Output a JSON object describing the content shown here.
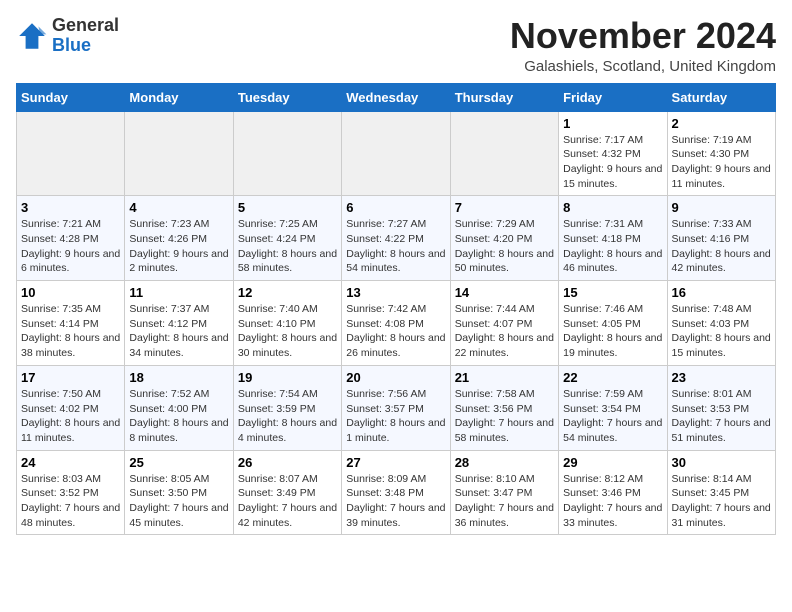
{
  "logo": {
    "general": "General",
    "blue": "Blue"
  },
  "title": "November 2024",
  "location": "Galashiels, Scotland, United Kingdom",
  "days_of_week": [
    "Sunday",
    "Monday",
    "Tuesday",
    "Wednesday",
    "Thursday",
    "Friday",
    "Saturday"
  ],
  "weeks": [
    [
      {
        "day": "",
        "info": ""
      },
      {
        "day": "",
        "info": ""
      },
      {
        "day": "",
        "info": ""
      },
      {
        "day": "",
        "info": ""
      },
      {
        "day": "",
        "info": ""
      },
      {
        "day": "1",
        "info": "Sunrise: 7:17 AM\nSunset: 4:32 PM\nDaylight: 9 hours and 15 minutes."
      },
      {
        "day": "2",
        "info": "Sunrise: 7:19 AM\nSunset: 4:30 PM\nDaylight: 9 hours and 11 minutes."
      }
    ],
    [
      {
        "day": "3",
        "info": "Sunrise: 7:21 AM\nSunset: 4:28 PM\nDaylight: 9 hours and 6 minutes."
      },
      {
        "day": "4",
        "info": "Sunrise: 7:23 AM\nSunset: 4:26 PM\nDaylight: 9 hours and 2 minutes."
      },
      {
        "day": "5",
        "info": "Sunrise: 7:25 AM\nSunset: 4:24 PM\nDaylight: 8 hours and 58 minutes."
      },
      {
        "day": "6",
        "info": "Sunrise: 7:27 AM\nSunset: 4:22 PM\nDaylight: 8 hours and 54 minutes."
      },
      {
        "day": "7",
        "info": "Sunrise: 7:29 AM\nSunset: 4:20 PM\nDaylight: 8 hours and 50 minutes."
      },
      {
        "day": "8",
        "info": "Sunrise: 7:31 AM\nSunset: 4:18 PM\nDaylight: 8 hours and 46 minutes."
      },
      {
        "day": "9",
        "info": "Sunrise: 7:33 AM\nSunset: 4:16 PM\nDaylight: 8 hours and 42 minutes."
      }
    ],
    [
      {
        "day": "10",
        "info": "Sunrise: 7:35 AM\nSunset: 4:14 PM\nDaylight: 8 hours and 38 minutes."
      },
      {
        "day": "11",
        "info": "Sunrise: 7:37 AM\nSunset: 4:12 PM\nDaylight: 8 hours and 34 minutes."
      },
      {
        "day": "12",
        "info": "Sunrise: 7:40 AM\nSunset: 4:10 PM\nDaylight: 8 hours and 30 minutes."
      },
      {
        "day": "13",
        "info": "Sunrise: 7:42 AM\nSunset: 4:08 PM\nDaylight: 8 hours and 26 minutes."
      },
      {
        "day": "14",
        "info": "Sunrise: 7:44 AM\nSunset: 4:07 PM\nDaylight: 8 hours and 22 minutes."
      },
      {
        "day": "15",
        "info": "Sunrise: 7:46 AM\nSunset: 4:05 PM\nDaylight: 8 hours and 19 minutes."
      },
      {
        "day": "16",
        "info": "Sunrise: 7:48 AM\nSunset: 4:03 PM\nDaylight: 8 hours and 15 minutes."
      }
    ],
    [
      {
        "day": "17",
        "info": "Sunrise: 7:50 AM\nSunset: 4:02 PM\nDaylight: 8 hours and 11 minutes."
      },
      {
        "day": "18",
        "info": "Sunrise: 7:52 AM\nSunset: 4:00 PM\nDaylight: 8 hours and 8 minutes."
      },
      {
        "day": "19",
        "info": "Sunrise: 7:54 AM\nSunset: 3:59 PM\nDaylight: 8 hours and 4 minutes."
      },
      {
        "day": "20",
        "info": "Sunrise: 7:56 AM\nSunset: 3:57 PM\nDaylight: 8 hours and 1 minute."
      },
      {
        "day": "21",
        "info": "Sunrise: 7:58 AM\nSunset: 3:56 PM\nDaylight: 7 hours and 58 minutes."
      },
      {
        "day": "22",
        "info": "Sunrise: 7:59 AM\nSunset: 3:54 PM\nDaylight: 7 hours and 54 minutes."
      },
      {
        "day": "23",
        "info": "Sunrise: 8:01 AM\nSunset: 3:53 PM\nDaylight: 7 hours and 51 minutes."
      }
    ],
    [
      {
        "day": "24",
        "info": "Sunrise: 8:03 AM\nSunset: 3:52 PM\nDaylight: 7 hours and 48 minutes."
      },
      {
        "day": "25",
        "info": "Sunrise: 8:05 AM\nSunset: 3:50 PM\nDaylight: 7 hours and 45 minutes."
      },
      {
        "day": "26",
        "info": "Sunrise: 8:07 AM\nSunset: 3:49 PM\nDaylight: 7 hours and 42 minutes."
      },
      {
        "day": "27",
        "info": "Sunrise: 8:09 AM\nSunset: 3:48 PM\nDaylight: 7 hours and 39 minutes."
      },
      {
        "day": "28",
        "info": "Sunrise: 8:10 AM\nSunset: 3:47 PM\nDaylight: 7 hours and 36 minutes."
      },
      {
        "day": "29",
        "info": "Sunrise: 8:12 AM\nSunset: 3:46 PM\nDaylight: 7 hours and 33 minutes."
      },
      {
        "day": "30",
        "info": "Sunrise: 8:14 AM\nSunset: 3:45 PM\nDaylight: 7 hours and 31 minutes."
      }
    ]
  ]
}
